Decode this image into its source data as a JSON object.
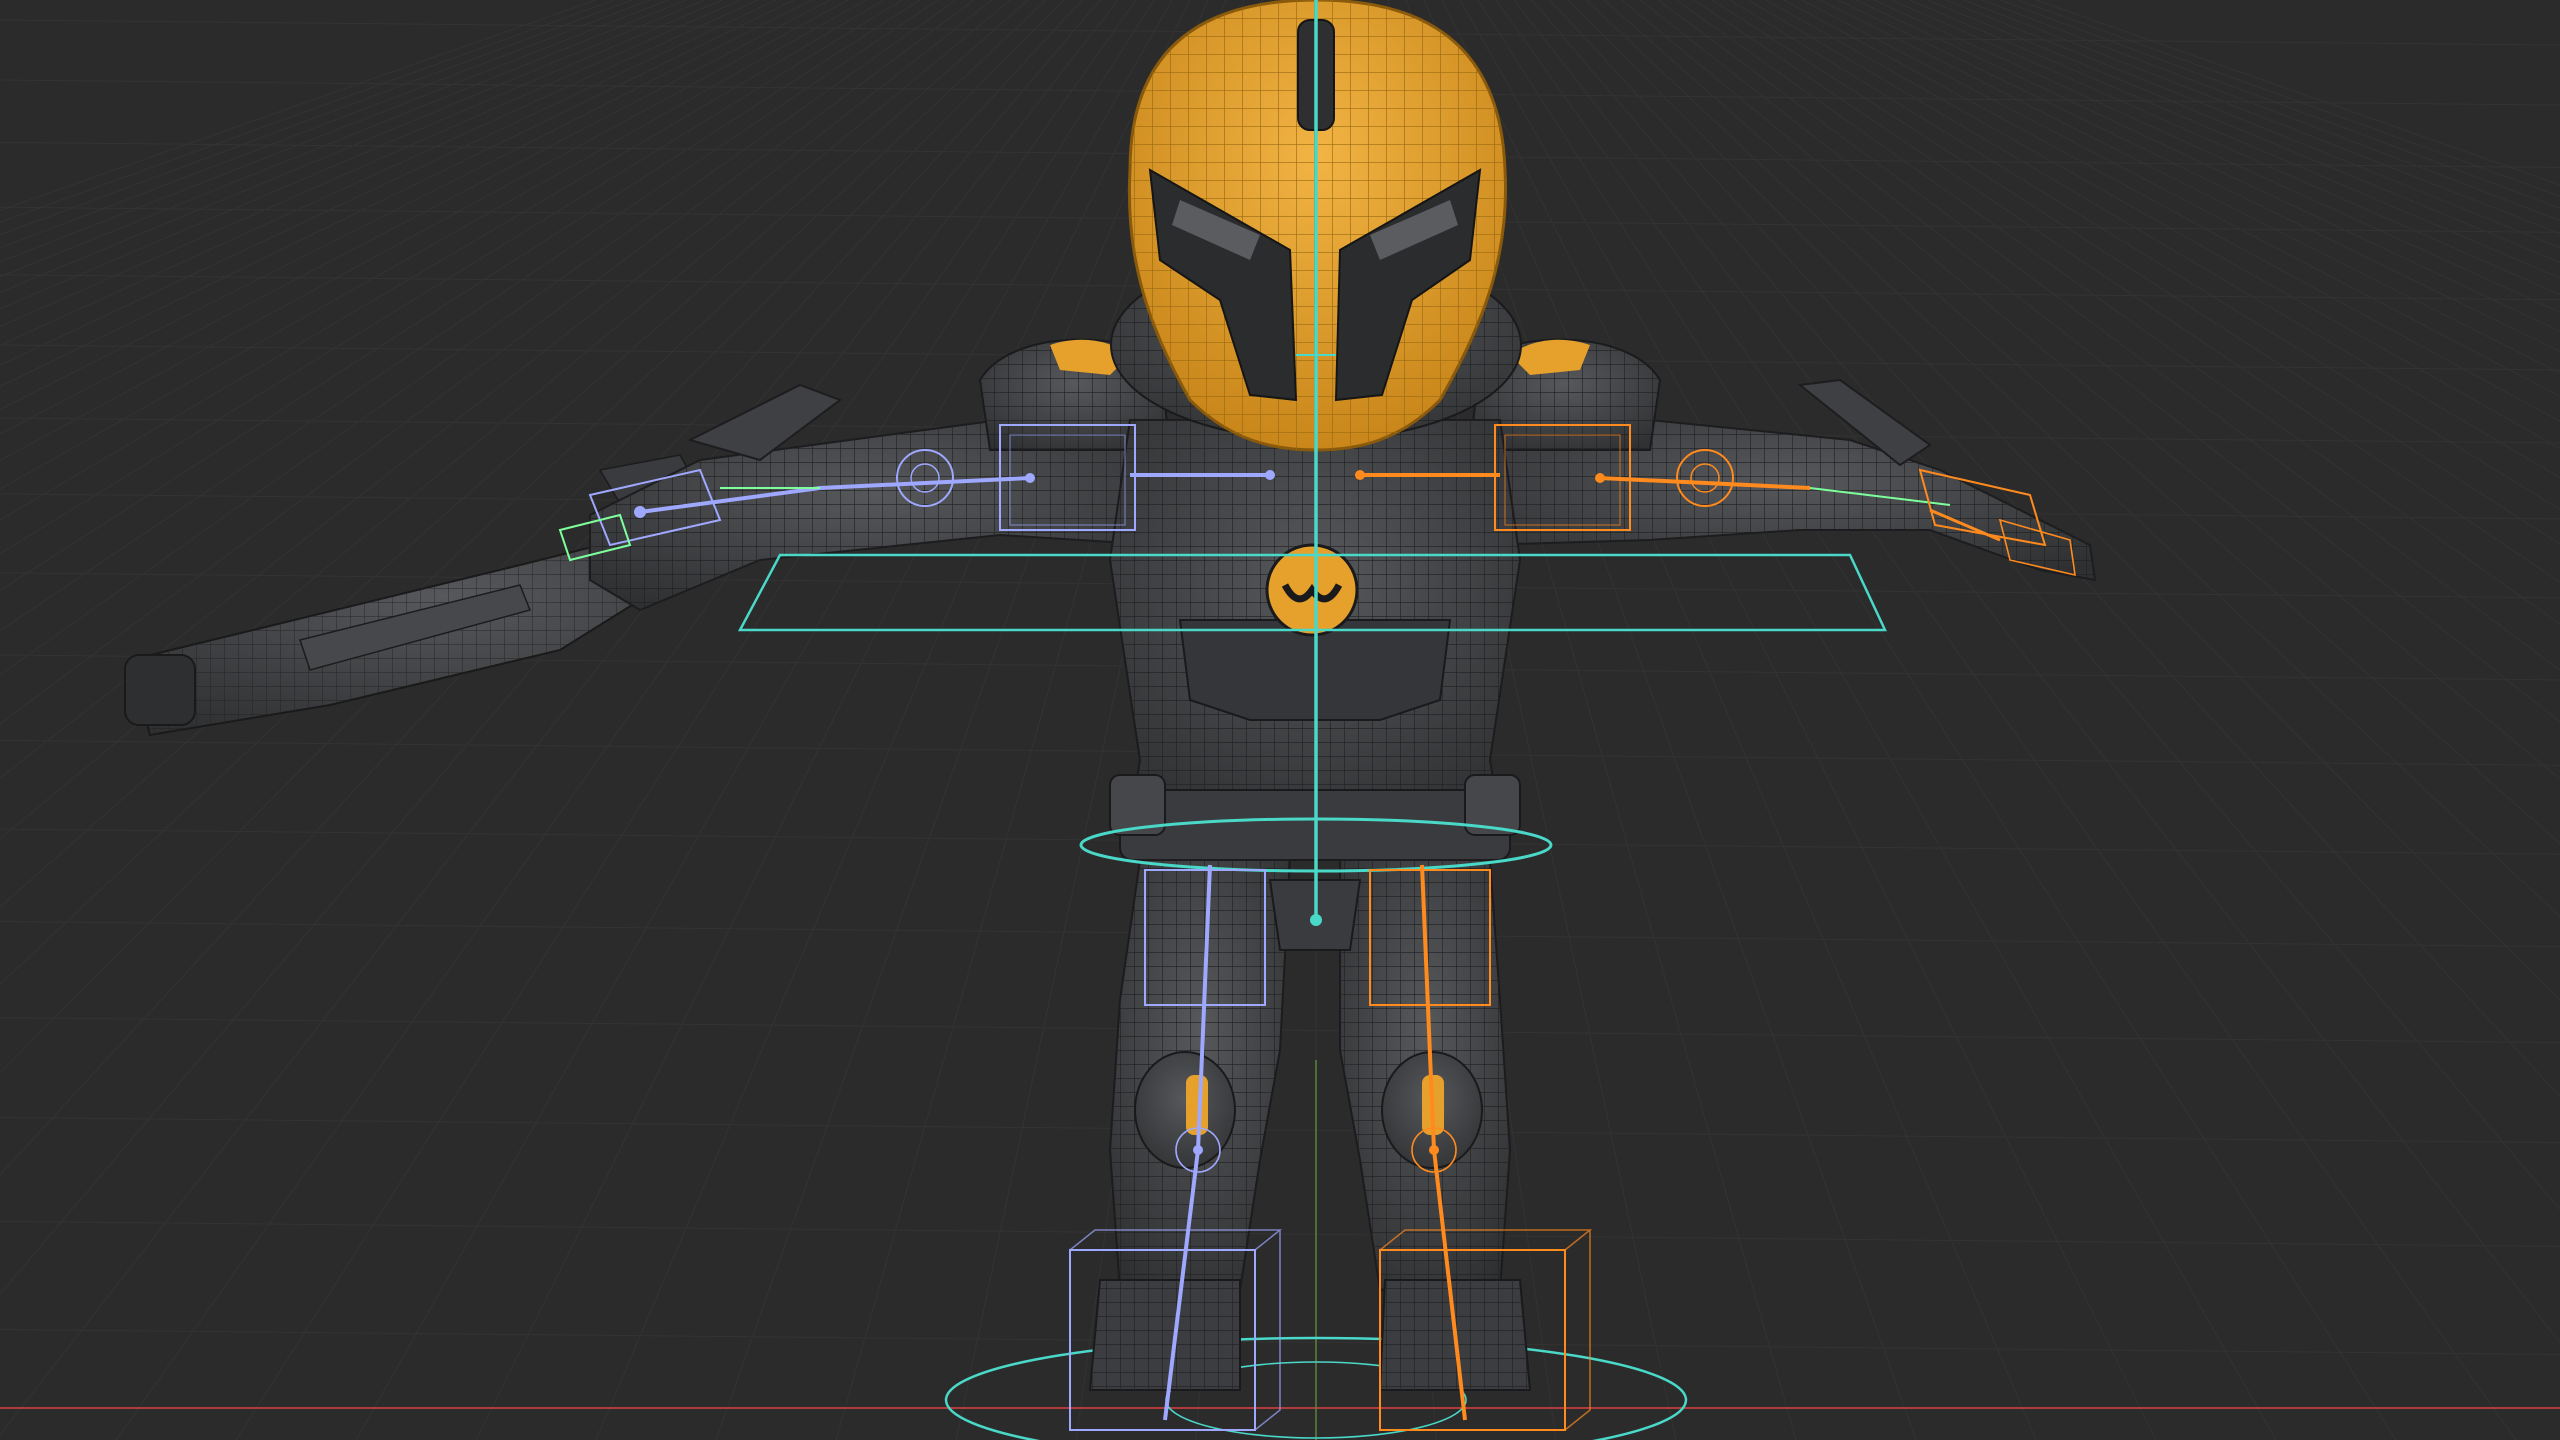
{
  "viewport": {
    "mode": "wireframe-overlay",
    "view": "front-orthographic",
    "subject": "rigged-character",
    "pose": "t-pose",
    "grid_visible": true
  },
  "colors": {
    "background": "#2b2b2b",
    "grid": "#333333",
    "grid_major": "#393939",
    "helmet": "#e5a12c",
    "armor_dark": "#3a3b3d",
    "body_dark": "#4a4b4d",
    "bone_left": "#9fa8ff",
    "bone_right": "#ff8a1e",
    "control_cyan": "#4ad8c8",
    "ik_green": "#7dff9c",
    "x_axis": "#b03b3b"
  },
  "rig": {
    "controls": [
      "root-circle",
      "hip-ring",
      "chest-plane",
      "spine-line"
    ],
    "left_chain": [
      "upper-arm",
      "forearm",
      "hand",
      "thigh",
      "shin",
      "foot"
    ],
    "right_chain": [
      "upper-arm",
      "forearm",
      "hand",
      "thigh",
      "shin",
      "foot"
    ],
    "prop": "rifle"
  }
}
